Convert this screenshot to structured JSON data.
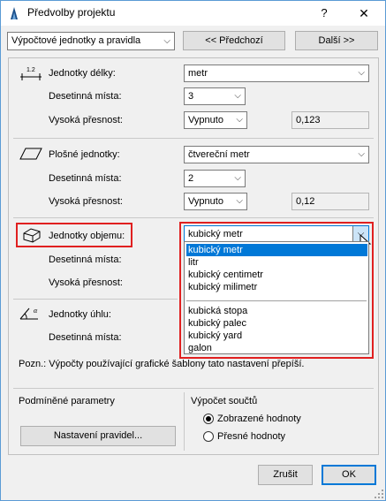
{
  "window": {
    "title": "Předvolby projektu",
    "help_glyph": "?",
    "close_glyph": "✕"
  },
  "toolbar": {
    "category_value": "Výpočtové jednotky a pravidla",
    "prev_label": "<< Předchozí",
    "next_label": "Další >>"
  },
  "length": {
    "label": "Jednotky délky:",
    "value": "metr",
    "decimals_label": "Desetinná místa:",
    "decimals_value": "3",
    "precision_label": "Vysoká přesnost:",
    "precision_value": "Vypnuto",
    "preview": "0,123"
  },
  "area": {
    "label": "Plošné jednotky:",
    "value": "čtvereční metr",
    "decimals_label": "Desetinná místa:",
    "decimals_value": "2",
    "precision_label": "Vysoká přesnost:",
    "precision_value": "Vypnuto",
    "preview": "0,12"
  },
  "volume": {
    "label": "Jednotky objemu:",
    "value": "kubický metr",
    "decimals_label": "Desetinná místa:",
    "precision_label": "Vysoká přesnost:",
    "options_group1": [
      "kubický metr",
      "litr",
      "kubický centimetr",
      "kubický milimetr"
    ],
    "options_group2": [
      "kubická stopa",
      "kubický palec",
      "kubický yard",
      "galon"
    ]
  },
  "angle": {
    "label": "Jednotky úhlu:",
    "decimals_label": "Desetinná místa:"
  },
  "note": "Pozn.: Výpočty používající grafické šablony tato nastavení přepíší.",
  "conditional": {
    "heading": "Podmíněné parametry",
    "rules_button": "Nastavení pravidel..."
  },
  "totals": {
    "heading": "Výpočet součtů",
    "option_displayed": "Zobrazené hodnoty",
    "option_exact": "Přesné hodnoty",
    "selected": "Zobrazené hodnoty"
  },
  "footer": {
    "cancel_label": "Zrušit",
    "ok_label": "OK"
  },
  "colors": {
    "highlight": "#e02020",
    "selection": "#0078d7"
  }
}
